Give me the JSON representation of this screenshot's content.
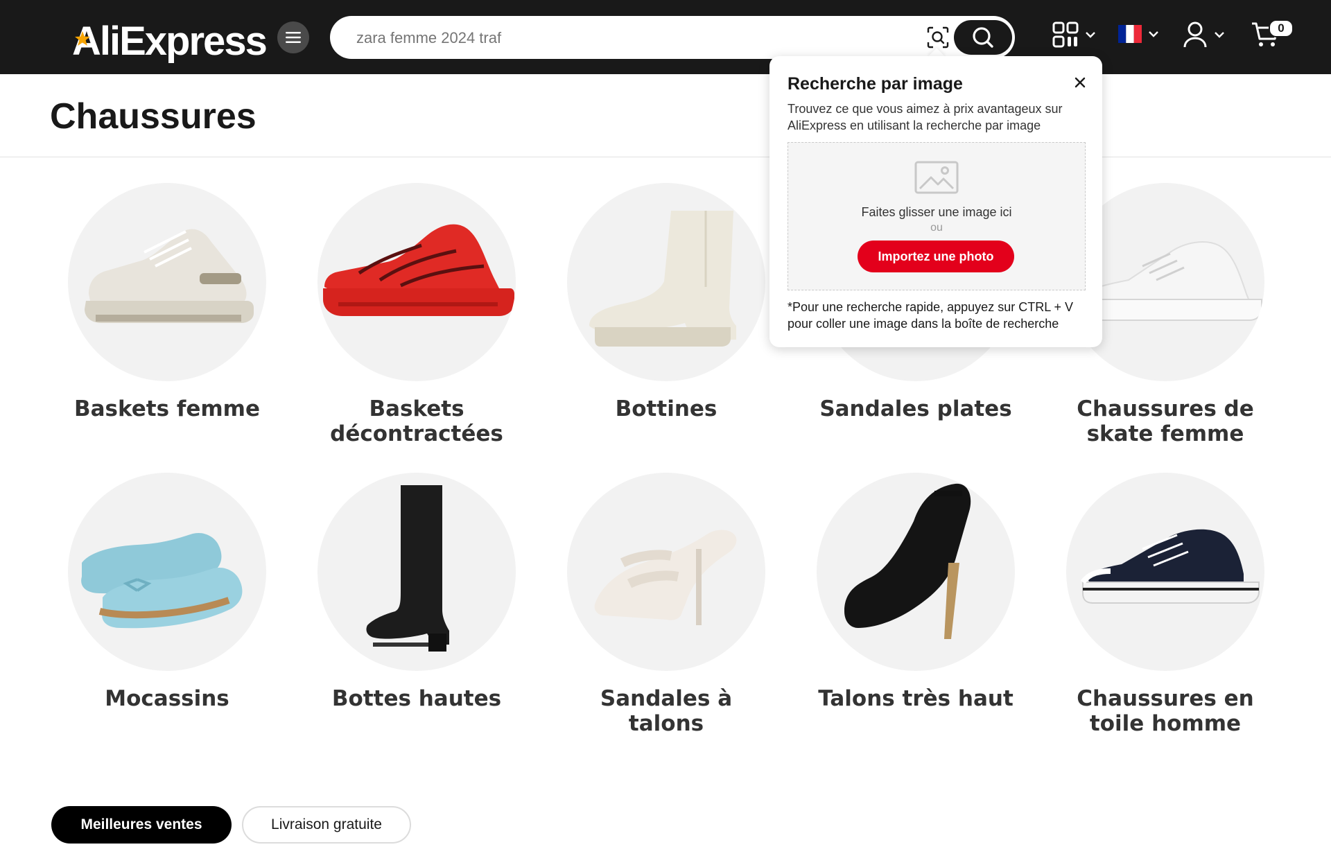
{
  "header": {
    "logo_text": "AliExpress",
    "search": {
      "value": "",
      "placeholder": "zara femme 2024 traf"
    },
    "cart_count": "0",
    "icons": [
      "menu-icon",
      "camera-search-icon",
      "search-icon",
      "qr-code-icon",
      "chevron-down-icon",
      "france-flag-icon",
      "user-icon",
      "cart-icon"
    ]
  },
  "page": {
    "title": "Chaussures"
  },
  "categories": [
    {
      "label": "Baskets femme"
    },
    {
      "label": "Baskets décontractées"
    },
    {
      "label": "Bottines"
    },
    {
      "label": "Sandales plates"
    },
    {
      "label": "Chaussures de skate femme"
    },
    {
      "label": "Mocassins"
    },
    {
      "label": "Bottes hautes"
    },
    {
      "label": "Sandales à talons"
    },
    {
      "label": "Talons très haut"
    },
    {
      "label": "Chaussures en toile homme"
    }
  ],
  "image_search_popup": {
    "title": "Recherche par image",
    "description": "Trouvez ce que vous aimez à prix avantageux sur AliExpress en utilisant la recherche par image",
    "drop_text": "Faites glisser une image ici",
    "or_text": "ou",
    "upload_button": "Importez une photo",
    "tip": "*Pour une recherche rapide, appuyez sur CTRL + V pour coller une image dans la boîte de recherche"
  },
  "filters": [
    {
      "label": "Meilleures ventes",
      "active": true
    },
    {
      "label": "Livraison gratuite",
      "active": false
    }
  ],
  "colors": {
    "header_bg": "#191919",
    "accent_red": "#e3001b",
    "circle_bg": "#f2f2f2",
    "logo_star": "#f7a400",
    "flag_blue": "#002395",
    "flag_red": "#ed2939"
  }
}
